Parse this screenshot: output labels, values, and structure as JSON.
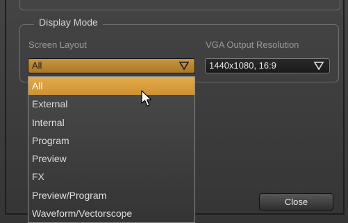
{
  "display_mode": {
    "group_title": "Display Mode",
    "screen_layout_label": "Screen Layout",
    "screen_layout_value": "All",
    "vga_label": "VGA Output Resolution",
    "vga_value": "1440x1080, 16:9"
  },
  "dropdown": {
    "options": [
      "All",
      "External",
      "Internal",
      "Program",
      "Preview",
      "FX",
      "Preview/Program",
      "Waveform/Vectorscope"
    ],
    "selected": "All"
  },
  "buttons": {
    "close_label": "Close"
  },
  "icons": {
    "combo_arrow": "triangle-down-icon",
    "pointer": "mouse-pointer-icon"
  },
  "colors": {
    "accent": "#d99e3e",
    "background": "#3e3e3e"
  }
}
